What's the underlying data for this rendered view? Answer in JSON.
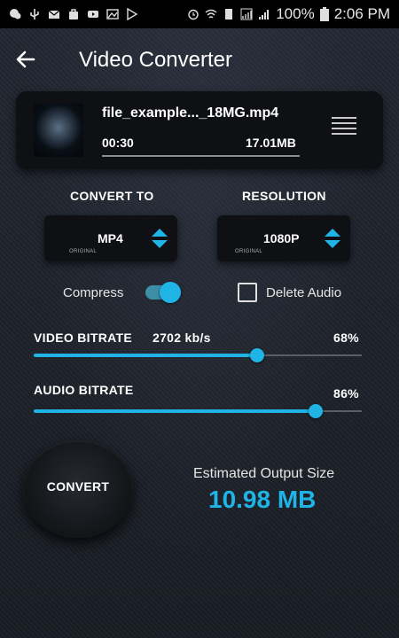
{
  "status_bar": {
    "battery": "100%",
    "time": "2:06 PM"
  },
  "app_bar": {
    "title": "Video Converter"
  },
  "file": {
    "name": "file_example..._18MG.mp4",
    "duration": "00:30",
    "size": "17.01MB"
  },
  "convert_to": {
    "label": "CONVERT TO",
    "value": "MP4",
    "sublabel": "ORIGINAL"
  },
  "resolution": {
    "label": "RESOLUTION",
    "value": "1080P",
    "sublabel": "ORIGINAL"
  },
  "options": {
    "compress_label": "Compress",
    "compress_on": true,
    "delete_audio_label": "Delete Audio",
    "delete_audio_checked": false
  },
  "video_bitrate": {
    "label": "VIDEO BITRATE",
    "value": "2702 kb/s",
    "percent_text": "68%",
    "level": 0.68
  },
  "audio_bitrate": {
    "label": "AUDIO BITRATE",
    "percent_text": "86%",
    "level": 0.86
  },
  "convert": {
    "label": "CONVERT"
  },
  "estimate": {
    "label": "Estimated Output Size",
    "value": "10.98 MB"
  },
  "colors": {
    "accent": "#1fb3e6",
    "background": "#1b1f26"
  }
}
